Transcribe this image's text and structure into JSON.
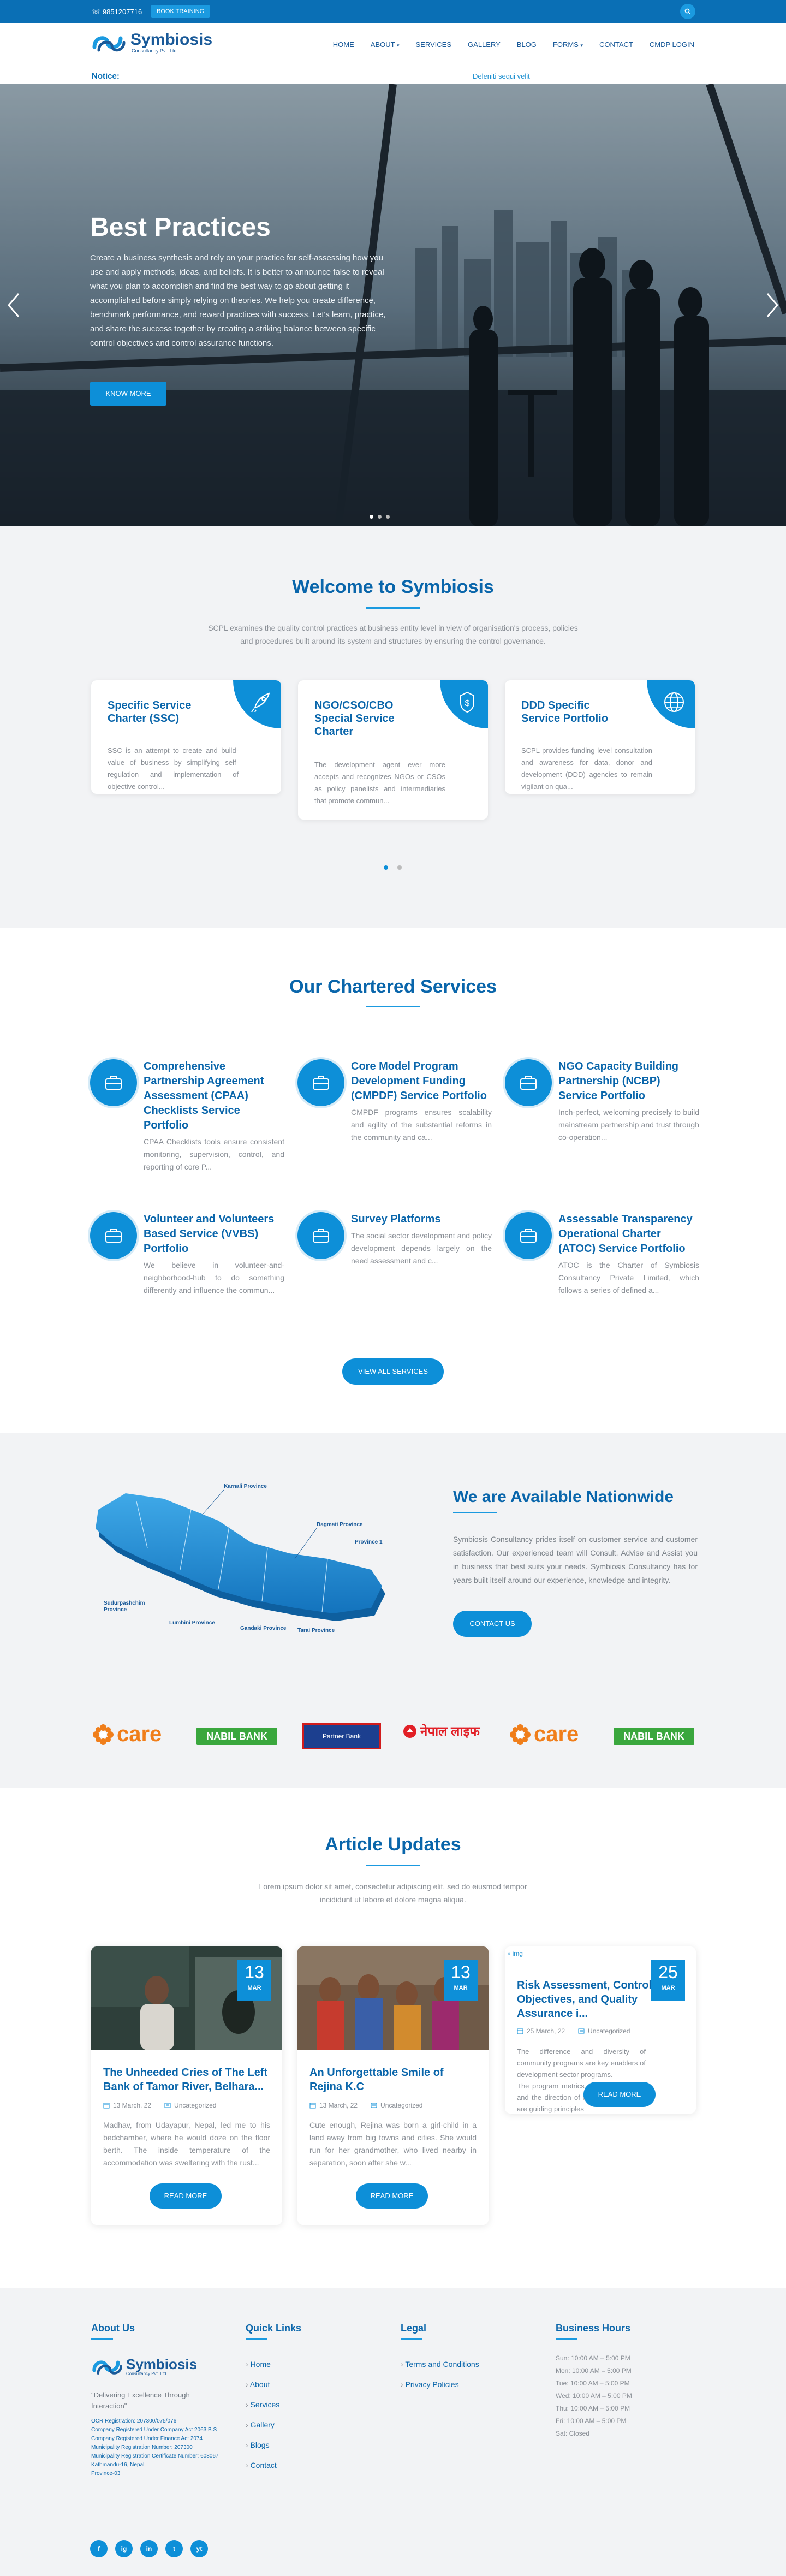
{
  "topbar": {
    "phone": "9851207716",
    "training_label": "BOOK TRAINING"
  },
  "header": {
    "logo_name": "Symbiosis",
    "logo_sub": "Consultancy Pvt. Ltd.",
    "nav": [
      "HOME",
      "ABOUT",
      "SERVICES",
      "GALLERY",
      "BLOG",
      "FORMS",
      "CONTACT",
      "CMDP LOGIN"
    ]
  },
  "notice": {
    "label": "Notice:",
    "message": "Deleniti sequi velit"
  },
  "hero": {
    "title": "Best Practices",
    "text": "Create a business synthesis and rely on your practice for self-assessing how you use and apply methods, ideas, and beliefs. It is better to announce false to reveal what you plan to accomplish and find the best way to go about getting it accomplished before simply relying on theories. We help you create difference, benchmark performance, and reward practices with success. Let's learn, practice, and share the success together by creating a striking balance between specific control objectives and control assurance functions.",
    "button": "KNOW MORE"
  },
  "welcome": {
    "title": "Welcome to Symbiosis",
    "subtitle": "SCPL examines the quality control practices at business entity level in view of organisation's process, policies and procedures built around its system and structures by ensuring the control governance.",
    "cards": [
      {
        "title": "Specific Service Charter (SSC)",
        "text": "SSC is an attempt to create and build-value of business by simplifying self-regulation and implementation of objective control..."
      },
      {
        "title": "NGO/CSO/CBO Special Service Charter",
        "text": "The development agent ever more accepts and recognizes NGOs or CSOs as policy panelists and intermediaries that promote commun..."
      },
      {
        "title": "DDD Specific Service Portfolio",
        "text": "SCPL provides funding level consultation and awareness for data, donor and development (DDD) agencies to remain vigilant on qua..."
      }
    ]
  },
  "services": {
    "title": "Our Chartered Services",
    "items": [
      {
        "title": "Comprehensive Partnership Agreement Assessment (CPAA) Checklists Service Portfolio",
        "text": "CPAA Checklists tools ensure consistent monitoring, supervision, control, and reporting of core P..."
      },
      {
        "title": "Core Model Program Development Funding (CMPDF) Service Portfolio",
        "text": "CMPDF programs ensures scalability and agility of the substantial reforms in the community and ca..."
      },
      {
        "title": "NGO Capacity Building Partnership (NCBP) Service Portfolio",
        "text": "Inch-perfect, welcoming precisely to build mainstream partnership and trust through co-operation..."
      },
      {
        "title": "Volunteer and Volunteers Based Service (VVBS) Portfolio",
        "text": "We believe in volunteer-and-neighborhood-hub to do something differently and influence the commun..."
      },
      {
        "title": "Survey Platforms",
        "text": "The social sector development and policy development depends largely on the need assessment and c..."
      },
      {
        "title": "Assessable Transparency Operational Charter (ATOC) Service Portfolio",
        "text": "ATOC is the Charter of Symbiosis Consultancy Private Limited, which follows a series of defined a..."
      }
    ],
    "button": "VIEW ALL SERVICES"
  },
  "nationwide": {
    "title": "We are Available Nationwide",
    "text": "Symbiosis Consultancy prides itself on customer service and customer satisfaction. Our experienced team will Consult, Advise and Assist you in business that best suits your needs. Symbiosis Consultancy has for years built itself around our experience, knowledge and integrity.",
    "button": "CONTACT US",
    "provinces": [
      "Karnali Province",
      "Bagmati Province",
      "Province 1",
      "Sudurpashchim Province",
      "Lumbini Province",
      "Gandaki Province",
      "Tarai Province"
    ]
  },
  "partners": [
    "care",
    "NABIL BANK",
    "Partner Bank",
    "नेपाल लाइफ",
    "care",
    "NABIL BANK"
  ],
  "articles": {
    "title": "Article Updates",
    "subtitle": "Lorem ipsum dolor sit amet, consectetur adipiscing elit, sed do eiusmod tempor incididunt ut labore et dolore magna aliqua.",
    "items": [
      {
        "day": "13",
        "month": "MAR",
        "title": "The Unheeded Cries of The Left Bank of Tamor River, Belhara...",
        "date": "13 March, 22",
        "category": "Uncategorized",
        "text": "Madhav, from Udayapur, Nepal, led me to his bedchamber, where he would doze on the floor berth. The inside temperature of the accommodation was sweltering with the rust...",
        "button": "READ MORE"
      },
      {
        "day": "13",
        "month": "MAR",
        "title": "An Unforgettable Smile of Rejina K.C",
        "date": "13 March, 22",
        "category": "Uncategorized",
        "text": "Cute enough, Rejina was born a girl-child in a land away from big towns and cities. She would run for her grandmother, who lived nearby in separation, soon after she w...",
        "button": "READ MORE"
      },
      {
        "day": "25",
        "month": "MAR",
        "title": "Risk Assessment, Control Objectives, and Quality Assurance i...",
        "date": "25 March, 22",
        "category": "Uncategorized",
        "img_alt": "img",
        "text": "The difference and diversity of community programs are key enablers of development sector programs.\nThe program metrics, immaculate focus and the direction of fund level practices are guiding principles",
        "button": "READ MORE"
      }
    ]
  },
  "footer": {
    "about_title": "About Us",
    "tagline": "\"Delivering Excellence Through Interaction\"",
    "registration": [
      "OCR Registration: 207300/075/076",
      "Company Registered Under Company Act 2063 B.S",
      "Company Registered Under Finance Act 2074",
      "Municipality Registration Number: 207300",
      "Municipality Registration Certificate Number: 608067",
      "Kathmandu-16, Nepal",
      "Province-03"
    ],
    "quick_title": "Quick Links",
    "quick_links": [
      "Home",
      "About",
      "Services",
      "Gallery",
      "Blogs",
      "Contact"
    ],
    "legal_title": "Legal",
    "legal_links": [
      "Terms and Conditions",
      "Privacy Policies"
    ],
    "hours_title": "Business Hours",
    "hours": [
      "Sun: 10:00 AM – 5:00 PM",
      "Mon: 10:00 AM – 5:00 PM",
      "Tue: 10:00 AM – 5:00 PM",
      "Wed: 10:00 AM – 5:00 PM",
      "Thu: 10:00 AM – 5:00 PM",
      "Fri: 10:00 AM – 5:00 PM",
      "Sat: Closed"
    ],
    "social": [
      "f",
      "ig",
      "in",
      "t",
      "yt"
    ]
  },
  "colors": {
    "primary": "#0a66ab",
    "accent": "#0d8fd8",
    "topbar": "#0a6fb5"
  }
}
